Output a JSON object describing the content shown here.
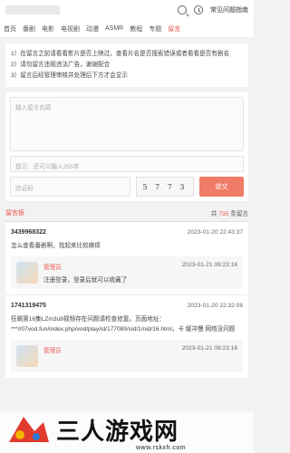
{
  "header": {
    "help_label": "常见问题指南"
  },
  "nav": {
    "items": [
      "首页",
      "番剧",
      "电影",
      "电视剧",
      "动漫",
      "ASMR",
      "教程",
      "专题",
      "留言"
    ],
    "active_index": 8
  },
  "notice": {
    "lines": [
      "1）在留言之前请看看影片是否上映过，查看片名是否搜索错误或者看看是否有剧名",
      "2）请勿留言违规违法广告，谢谢配合",
      "3）留言后经管理审核并处理后下方才会显示"
    ]
  },
  "form": {
    "content_placeholder": "输入留言内容",
    "hint": "提示：还可以输入255字",
    "captcha_placeholder": "验证码",
    "captcha_text": "5 7 7 3",
    "submit_label": "提交"
  },
  "board": {
    "title": "留言板",
    "count_prefix": "共",
    "count": "735",
    "count_suffix": "条留言"
  },
  "messages": [
    {
      "user": "3439968322",
      "time": "2023-01-20 22:43:37",
      "text": "怎么查看番剧啊，找起来比较麻烦",
      "reply": {
        "user": "管理员",
        "time": "2023-01-21 09:23:16",
        "text": "注册登录，登录后就可以收藏了"
      }
    },
    {
      "user": "1741319475",
      "time": "2023-01-20 22:32:08",
      "text": "狂飙第16集LZm3u8视频存在问题请检查修复。页面地址：***//07vod.fun/index.php/vod/play/id/177089/sid/1/nid/16.html，卡 缓冲慢 网络没问题",
      "reply": {
        "user": "管理员",
        "time": "2023-01-21 09:23:16",
        "text": ""
      }
    }
  ],
  "watermark": {
    "text": "三人游戏网",
    "url": "www.rskxh.com"
  },
  "colors": {
    "accent": "#e8564f",
    "submit": "#f07b67"
  }
}
